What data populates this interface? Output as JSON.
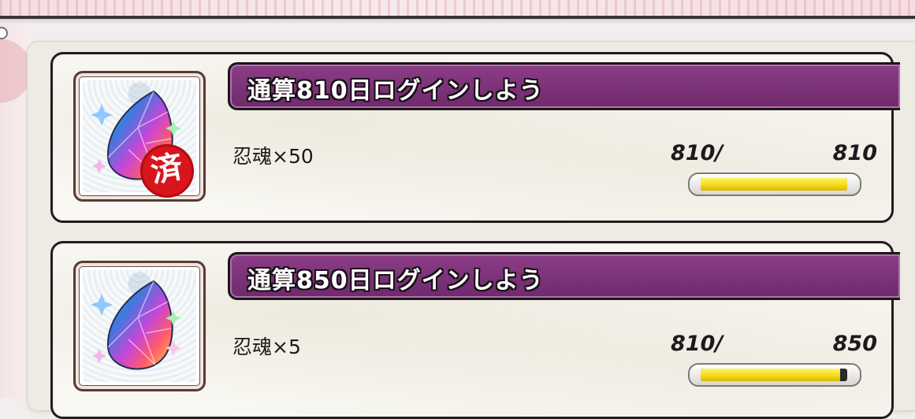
{
  "missions": [
    {
      "title": "通算810日ログインしよう",
      "reward": "忍魂×50",
      "progress_current": "810/",
      "progress_target": "810",
      "progress_fraction": 1.0,
      "completed": true,
      "completed_stamp": "済",
      "icon": "rainbow-gem-icon"
    },
    {
      "title": "通算850日ログインしよう",
      "reward": "忍魂×5",
      "progress_current": "810/",
      "progress_target": "850",
      "progress_fraction": 0.953,
      "completed": false,
      "icon": "rainbow-gem-icon"
    }
  ],
  "colors": {
    "title_bar": "#7a3277",
    "progress_fill": "#f3d716",
    "completed_seal": "#d9151c"
  }
}
